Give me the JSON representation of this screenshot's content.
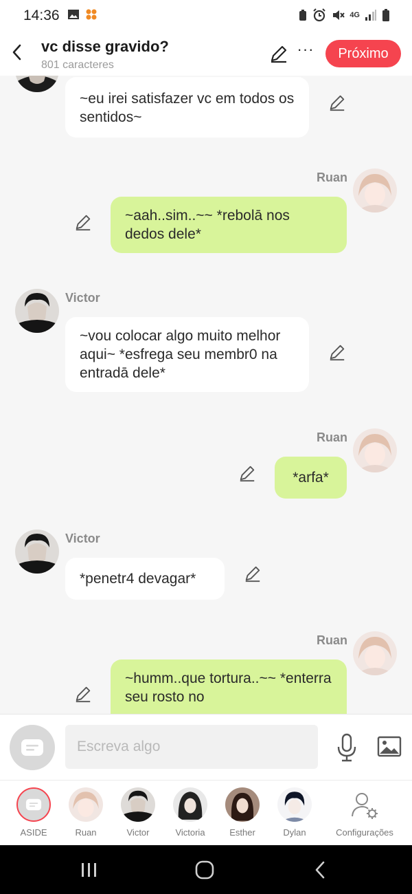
{
  "status": {
    "time": "14:36",
    "network": "4G"
  },
  "header": {
    "title": "vc disse gravido?",
    "subtitle": "801 caracteres",
    "next_label": "Próximo",
    "accent_color": "#f5444f"
  },
  "messages": [
    {
      "side": "left",
      "speaker": "",
      "text": "~eu irei satisfazer vc em todos os sentidos~"
    },
    {
      "side": "right",
      "speaker": "Ruan",
      "text": "~aah..sim..~~ *rebolā nos dedos dele*"
    },
    {
      "side": "left",
      "speaker": "Victor",
      "text": "~vou colocar algo muito melhor aqui~ *esfrega seu membr0 na entradā dele*"
    },
    {
      "side": "right",
      "speaker": "Ruan",
      "text": "*arfa*"
    },
    {
      "side": "left",
      "speaker": "Victor",
      "text": "*penetr4 devagar*"
    },
    {
      "side": "right",
      "speaker": "Ruan",
      "text": "~humm..que tortura..~~ *enterra seu rosto no"
    }
  ],
  "input": {
    "placeholder": "Escreva algo"
  },
  "characters": [
    {
      "label": "ASIDE",
      "icon": "aside-icon"
    },
    {
      "label": "Ruan",
      "icon": "ruan-avatar"
    },
    {
      "label": "Victor",
      "icon": "victor-avatar"
    },
    {
      "label": "Victoria",
      "icon": "victoria-avatar"
    },
    {
      "label": "Esther",
      "icon": "esther-avatar"
    },
    {
      "label": "Dylan",
      "icon": "dylan-avatar"
    },
    {
      "label": "Configurações",
      "icon": "settings-user-icon"
    }
  ],
  "colors": {
    "user_bubble": "#d8f49a",
    "bot_bubble": "#ffffff"
  }
}
